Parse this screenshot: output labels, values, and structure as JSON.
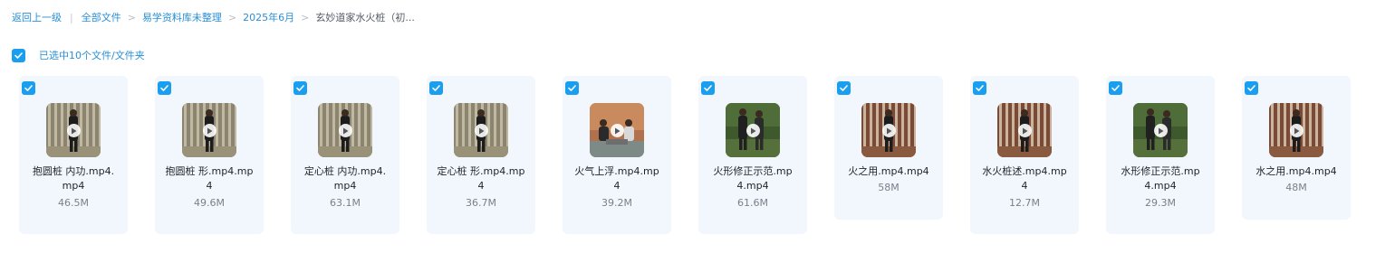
{
  "breadcrumb": {
    "back": "返回上一级",
    "items": [
      "全部文件",
      "易学资料库未整理",
      "2025年6月"
    ],
    "current": "玄妙道家水火桩（初..."
  },
  "selection": {
    "label": "已选中10个文件/文件夹"
  },
  "files": [
    {
      "name_line1": "抱圆桩 内功.mp4.",
      "name_line2": "mp4",
      "size": "46.5M",
      "thumb": "forest"
    },
    {
      "name_line1": "抱圆桩 形.mp4.mp",
      "name_line2": "4",
      "size": "49.6M",
      "thumb": "forest"
    },
    {
      "name_line1": "定心桩 内功.mp4.",
      "name_line2": "mp4",
      "size": "63.1M",
      "thumb": "forest"
    },
    {
      "name_line1": "定心桩 形.mp4.mp",
      "name_line2": "4",
      "size": "36.7M",
      "thumb": "forest"
    },
    {
      "name_line1": "火气上浮.mp4.mp",
      "name_line2": "4",
      "size": "39.2M",
      "thumb": "rock"
    },
    {
      "name_line1": "火形修正示范.mp",
      "name_line2": "4.mp4",
      "size": "61.6M",
      "thumb": "green"
    },
    {
      "name_line1": "火之用.mp4.mp4",
      "name_line2": "",
      "size": "58M",
      "thumb": "forest-red"
    },
    {
      "name_line1": "水火桩述.mp4.mp",
      "name_line2": "4",
      "size": "12.7M",
      "thumb": "forest-red"
    },
    {
      "name_line1": "水形修正示范.mp",
      "name_line2": "4.mp4",
      "size": "29.3M",
      "thumb": "green"
    },
    {
      "name_line1": "水之用.mp4.mp4",
      "name_line2": "",
      "size": "48M",
      "thumb": "forest-red"
    }
  ],
  "icons": {
    "checkbox": "checkbox-checked-icon",
    "play": "play-icon",
    "separator": "chevron-right-icon"
  },
  "colors": {
    "accent": "#1a9ff0",
    "link": "#2a8fd6",
    "tile_bg": "#f1f7fd"
  }
}
